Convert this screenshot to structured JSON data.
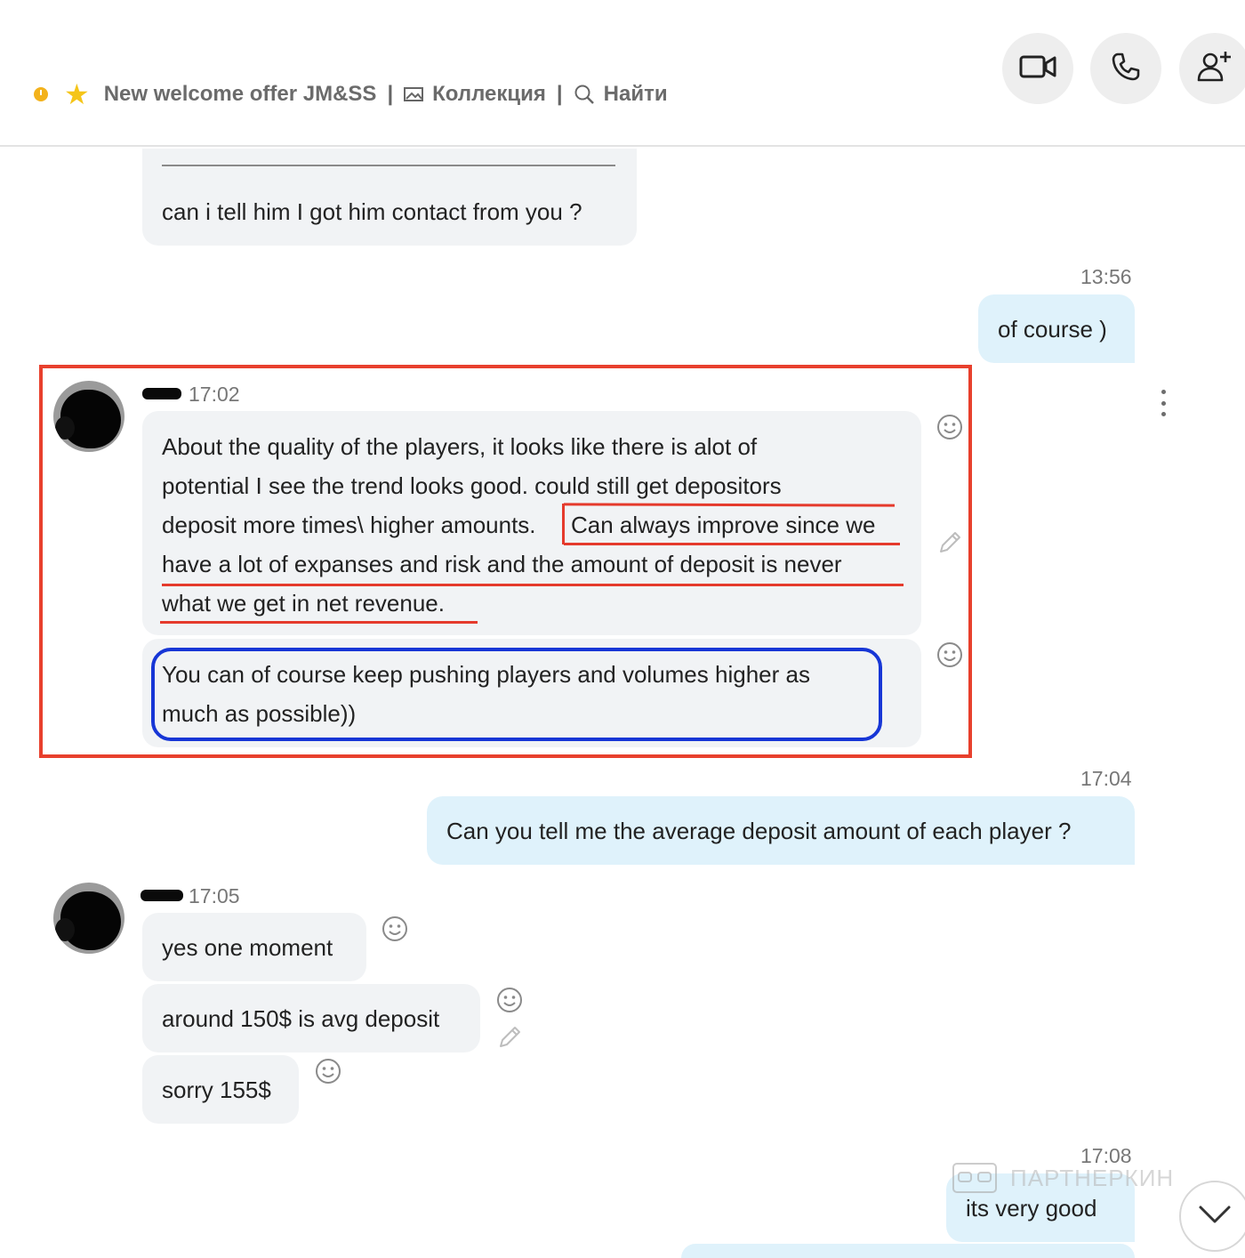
{
  "header": {
    "title": "New welcome offer JM&SS",
    "separator": "|",
    "collection_label": "Коллекция",
    "search_label": "Найти"
  },
  "messages": {
    "m1": {
      "text": "can i tell him I got him contact from you ?"
    },
    "m2": {
      "time": "13:56",
      "text": "of course )"
    },
    "group1": {
      "time": "17:02",
      "m3": {
        "line1": "About the quality of the players, it looks like there is alot of",
        "line2": "potential I see the trend looks good. could still get depositors",
        "line3a": "deposit more times\\ higher amounts.",
        "line3b": "Can always improve since we",
        "line4": "have a lot of expanses and risk and the amount of deposit is never",
        "line5": "what we get in net revenue."
      },
      "m4": {
        "line1": "You can of course keep pushing players and volumes higher as",
        "line2": "much as possible))"
      }
    },
    "m5": {
      "time": "17:04",
      "text": "Can you tell me the average deposit amount of each player ?"
    },
    "group2": {
      "time": "17:05",
      "m6": {
        "text": "yes one moment"
      },
      "m7": {
        "text": "around 150$ is avg deposit"
      },
      "m8": {
        "text": "sorry 155$"
      }
    },
    "m9": {
      "time": "17:08",
      "text": "its very good"
    }
  },
  "watermark": {
    "text": "ПАРТНЕРКИН"
  },
  "colors": {
    "incoming_bubble": "#f1f3f5",
    "outgoing_bubble": "#dff2fb",
    "annotation_red": "#e8402d",
    "annotation_blue": "#1736d6",
    "status_dot": "#f3b21c"
  },
  "icons": [
    "clock-icon",
    "star-icon",
    "image-icon",
    "search-icon",
    "video-camera-icon",
    "phone-icon",
    "add-contact-icon",
    "emoji-icon",
    "pencil-icon",
    "more-options-icon",
    "chevron-down-icon"
  ]
}
